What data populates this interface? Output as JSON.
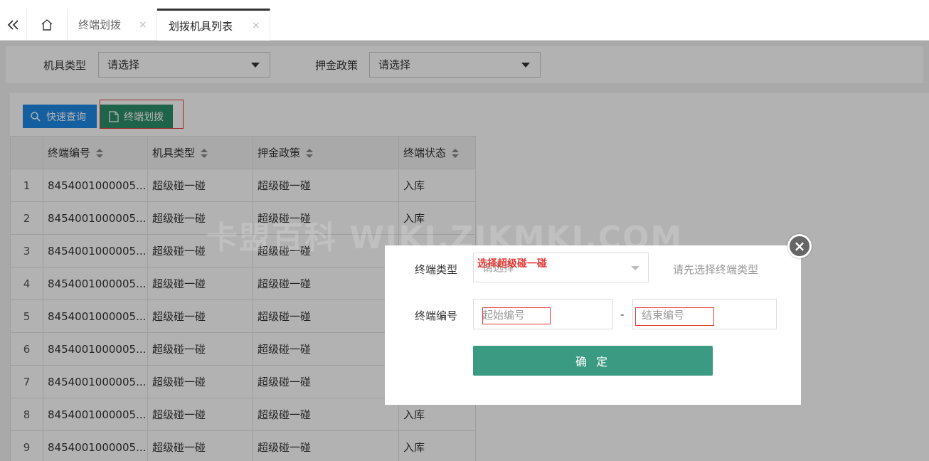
{
  "tabs": {
    "items": [
      {
        "label": "终端划拨"
      },
      {
        "label": "划拨机具列表"
      }
    ],
    "close_glyph": "×"
  },
  "filters": {
    "device_type_label": "机具类型",
    "device_type_value": "请选择",
    "deposit_policy_label": "押金政策",
    "deposit_policy_value": "请选择"
  },
  "toolbar": {
    "quick_query_label": "快速查询",
    "terminal_assign_label": "终端划拨"
  },
  "table": {
    "columns": [
      "终端编号",
      "机具类型",
      "押金政策",
      "终端状态"
    ],
    "rows": [
      {
        "index": "1",
        "terminal_no": "8454001000005...",
        "device_type": "超级碰一碰",
        "deposit_policy": "超级碰一碰",
        "status": "入库"
      },
      {
        "index": "2",
        "terminal_no": "8454001000005...",
        "device_type": "超级碰一碰",
        "deposit_policy": "超级碰一碰",
        "status": "入库"
      },
      {
        "index": "3",
        "terminal_no": "8454001000005...",
        "device_type": "超级碰一碰",
        "deposit_policy": "超级碰一碰",
        "status": ""
      },
      {
        "index": "4",
        "terminal_no": "8454001000005...",
        "device_type": "超级碰一碰",
        "deposit_policy": "超级碰一碰",
        "status": ""
      },
      {
        "index": "5",
        "terminal_no": "8454001000005...",
        "device_type": "超级碰一碰",
        "deposit_policy": "超级碰一碰",
        "status": ""
      },
      {
        "index": "6",
        "terminal_no": "8454001000005...",
        "device_type": "超级碰一碰",
        "deposit_policy": "超级碰一碰",
        "status": ""
      },
      {
        "index": "7",
        "terminal_no": "8454001000005...",
        "device_type": "超级碰一碰",
        "deposit_policy": "超级碰一碰",
        "status": ""
      },
      {
        "index": "8",
        "terminal_no": "8454001000005...",
        "device_type": "超级碰一碰",
        "deposit_policy": "超级碰一碰",
        "status": "入库"
      },
      {
        "index": "9",
        "terminal_no": "8454001000005...",
        "device_type": "超级碰一碰",
        "deposit_policy": "超级碰一碰",
        "status": "入库"
      }
    ]
  },
  "watermark": "卡盟百科 WIKI.ZJKMKJ.COM",
  "modal": {
    "terminal_type_label": "终端类型",
    "terminal_type_value": "请选择",
    "annotation": "选择超级碰一碰",
    "hint": "请先选择终端类型",
    "terminal_no_label": "终端编号",
    "start_placeholder": "起始编号",
    "range_separator": "-",
    "end_placeholder": "结束编号",
    "confirm_label": "确 定",
    "close_glyph": "×"
  },
  "colors": {
    "primary_blue": "#1e88e5",
    "assign_green": "#2f8f6c",
    "confirm_green": "#3a9a82",
    "annotation_red": "#e53935"
  }
}
